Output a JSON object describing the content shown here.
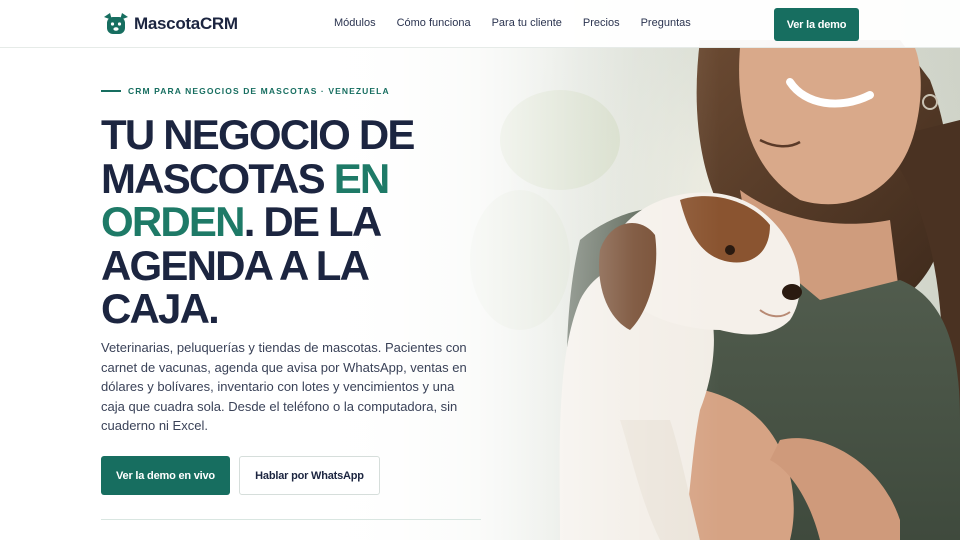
{
  "brand": {
    "name_part1": "Mascota",
    "name_part2": "CRM",
    "logo_icon": "dog-face-icon"
  },
  "nav": {
    "items": [
      {
        "label": "Módulos"
      },
      {
        "label": "Cómo funciona"
      },
      {
        "label": "Para tu cliente"
      },
      {
        "label": "Precios"
      },
      {
        "label": "Preguntas"
      }
    ],
    "cta_label": "Ver la demo"
  },
  "hero": {
    "eyebrow": "CRM PARA NEGOCIOS DE MASCOTAS · VENEZUELA",
    "headline_part1": "TU NEGOCIO DE MASCOTAS ",
    "headline_accent": "EN ORDEN",
    "headline_part2": ". DE LA AGENDA A LA CAJA.",
    "lead": "Veterinarias, peluquerías y tiendas de mascotas. Pacientes con carnet de vacunas, agenda que avisa por WhatsApp, ventas en dólares y bolívares, inventario con lotes y vencimientos y una caja que cuadra sola. Desde el teléfono o la computadora, sin cuaderno ni Excel.",
    "primary_button": "Ver la demo en vivo",
    "secondary_button": "Hablar por WhatsApp",
    "image_subject": "woman-holding-puppy-photo"
  },
  "colors": {
    "accent": "#176e60",
    "accent_text": "#1e7a67",
    "heading": "#1c2540",
    "body_text": "#3a4258"
  }
}
